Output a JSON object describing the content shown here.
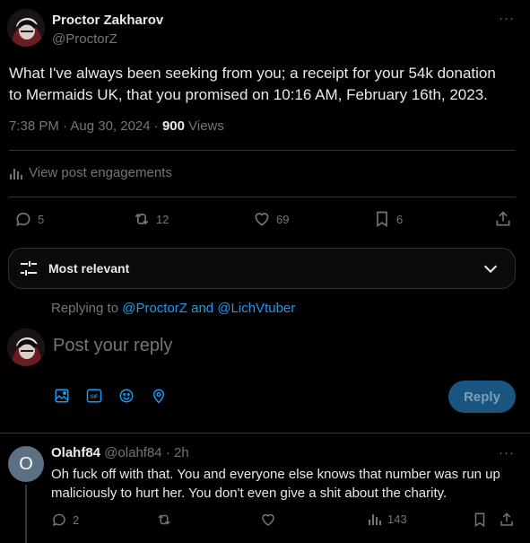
{
  "post": {
    "author_name": "Proctor Zakharov",
    "author_handle": "@ProctorZ",
    "more": "···",
    "text_line1": "What I've always been seeking from you; a receipt for your 54k donation",
    "text_line2": "to Mermaids UK, that you promised on 10:16 AM, February 16th, 2023.",
    "time": "7:38 PM · Aug 30, 2024 · ",
    "views_count": "900",
    "views_label": " Views"
  },
  "engagements": {
    "label": "View post engagements"
  },
  "actions": {
    "replies": "5",
    "reposts": "12",
    "likes": "69",
    "bookmarks": "6"
  },
  "sort": {
    "label": "Most relevant"
  },
  "reply_box": {
    "replying_prefix": "Replying to ",
    "replying_targets": "@ProctorZ and @LichVtuber",
    "placeholder": "Post your reply",
    "reply_button": "Reply"
  },
  "comment": {
    "avatar_letter": "O",
    "author_name": "Olahf84",
    "author_handle": "@olahf84 · 2h",
    "more": "···",
    "text_line1": "Oh fuck off with that. You and everyone else knows that number was run up",
    "text_line2": "maliciously to hurt her. You don't even give a shit about the charity.",
    "replies": "2",
    "views": "143"
  },
  "colors": {
    "accent": "#1d9bf0",
    "background": "#000000",
    "muted": "#71767b",
    "reply_button_bg": "#1a5480"
  }
}
